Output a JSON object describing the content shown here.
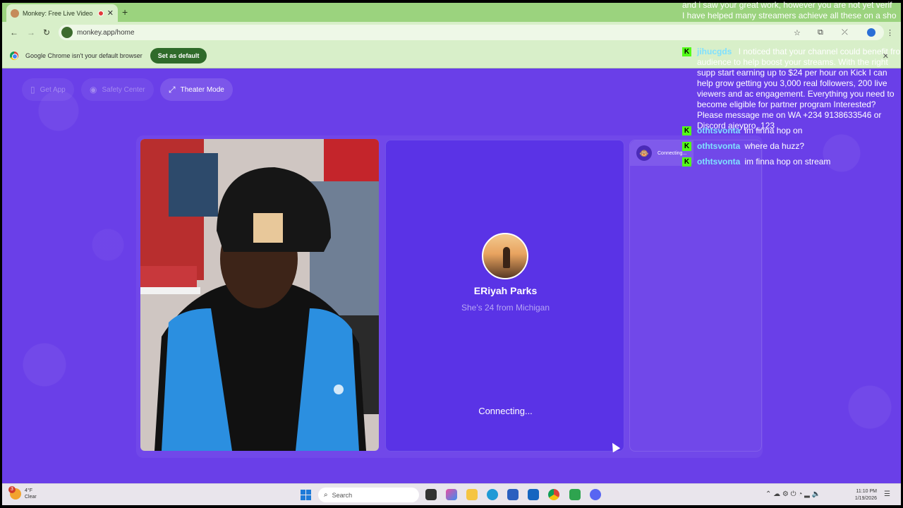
{
  "browser": {
    "tab_title": "Monkey: Free Live Video Ch",
    "tab_close": "✕",
    "new_tab": "+",
    "url": "monkey.app/home",
    "back": "←",
    "forward": "→",
    "reload": "↻",
    "infobar_message": "Google Chrome isn't your default browser",
    "set_default_label": "Set as default",
    "infobar_close": "✕"
  },
  "nav": {
    "get_app": "Get App",
    "safety_center": "Safety Center",
    "theater_mode": "Theater Mode"
  },
  "peer": {
    "name": "ERiyah Parks",
    "subtitle": "She's 24 from Michigan",
    "status": "Connecting..."
  },
  "side_panel": {
    "chip_label": "Connecting...",
    "chip_emoji": "🐵"
  },
  "chat": {
    "intro_lines": [
      "and i saw your great work, however you are not yet verif",
      "I have helped many streamers achieve all these on a sho"
    ],
    "messages": [
      {
        "user": "jihucgds",
        "text": "I noticed that your channel could benefit fro audience to help boost your streams. With the right supp start earning up to $24 per hour on Kick I can help grow getting you 3,000 real followers, 200 live viewers and ac engagement. Everything you need to become eligible for partner program Interested? Please message me on WA +234 9138633546 or Discord ajeypro_123"
      },
      {
        "user": "othtsvonta",
        "text": "im finna hop on"
      },
      {
        "user": "othtsvonta",
        "text": "where da huzz?"
      },
      {
        "user": "othtsvonta",
        "text": "im finna hop on stream"
      }
    ],
    "platform_badge": "K"
  },
  "taskbar": {
    "weather_temp": "4°F",
    "weather_cond": "Clear",
    "weather_badge": "3",
    "search_label": "Search",
    "time": "11:10 PM",
    "date": "1/19/2026"
  },
  "colors": {
    "page_bg": "#6a3fe8",
    "chrome_green": "#9bd37e",
    "kick_green": "#53fc18",
    "username_cyan": "#7fe0ff"
  }
}
